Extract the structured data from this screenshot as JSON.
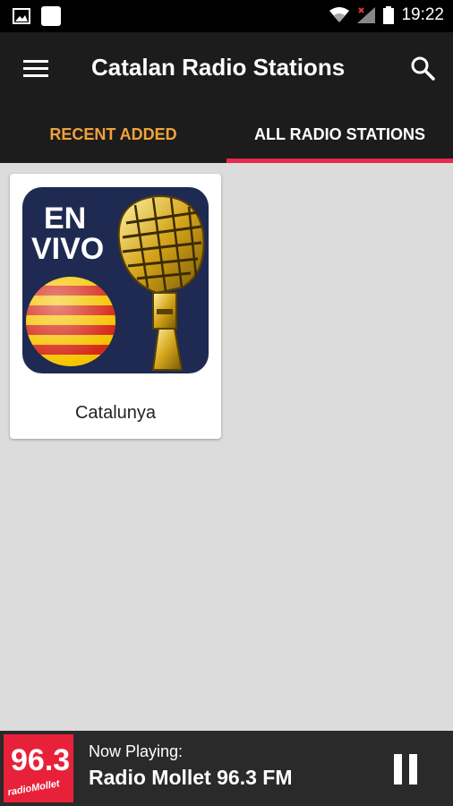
{
  "status_bar": {
    "time": "19:22"
  },
  "app_bar": {
    "title": "Catalan Radio Stations"
  },
  "tabs": [
    {
      "label": "RECENT ADDED",
      "active": false,
      "color": "#f0a23a"
    },
    {
      "label": "ALL RADIO STATIONS",
      "active": true,
      "color": "#ffffff"
    }
  ],
  "indicator_color": "#e8284d",
  "stations": [
    {
      "name": "Catalunya",
      "image_text": [
        "EN",
        "VIVO"
      ]
    }
  ],
  "player": {
    "now_playing_label": "Now Playing:",
    "station_title": "Radio Mollet 96.3 FM",
    "logo_text": [
      "96.3",
      "radioMollet"
    ],
    "state": "playing"
  }
}
